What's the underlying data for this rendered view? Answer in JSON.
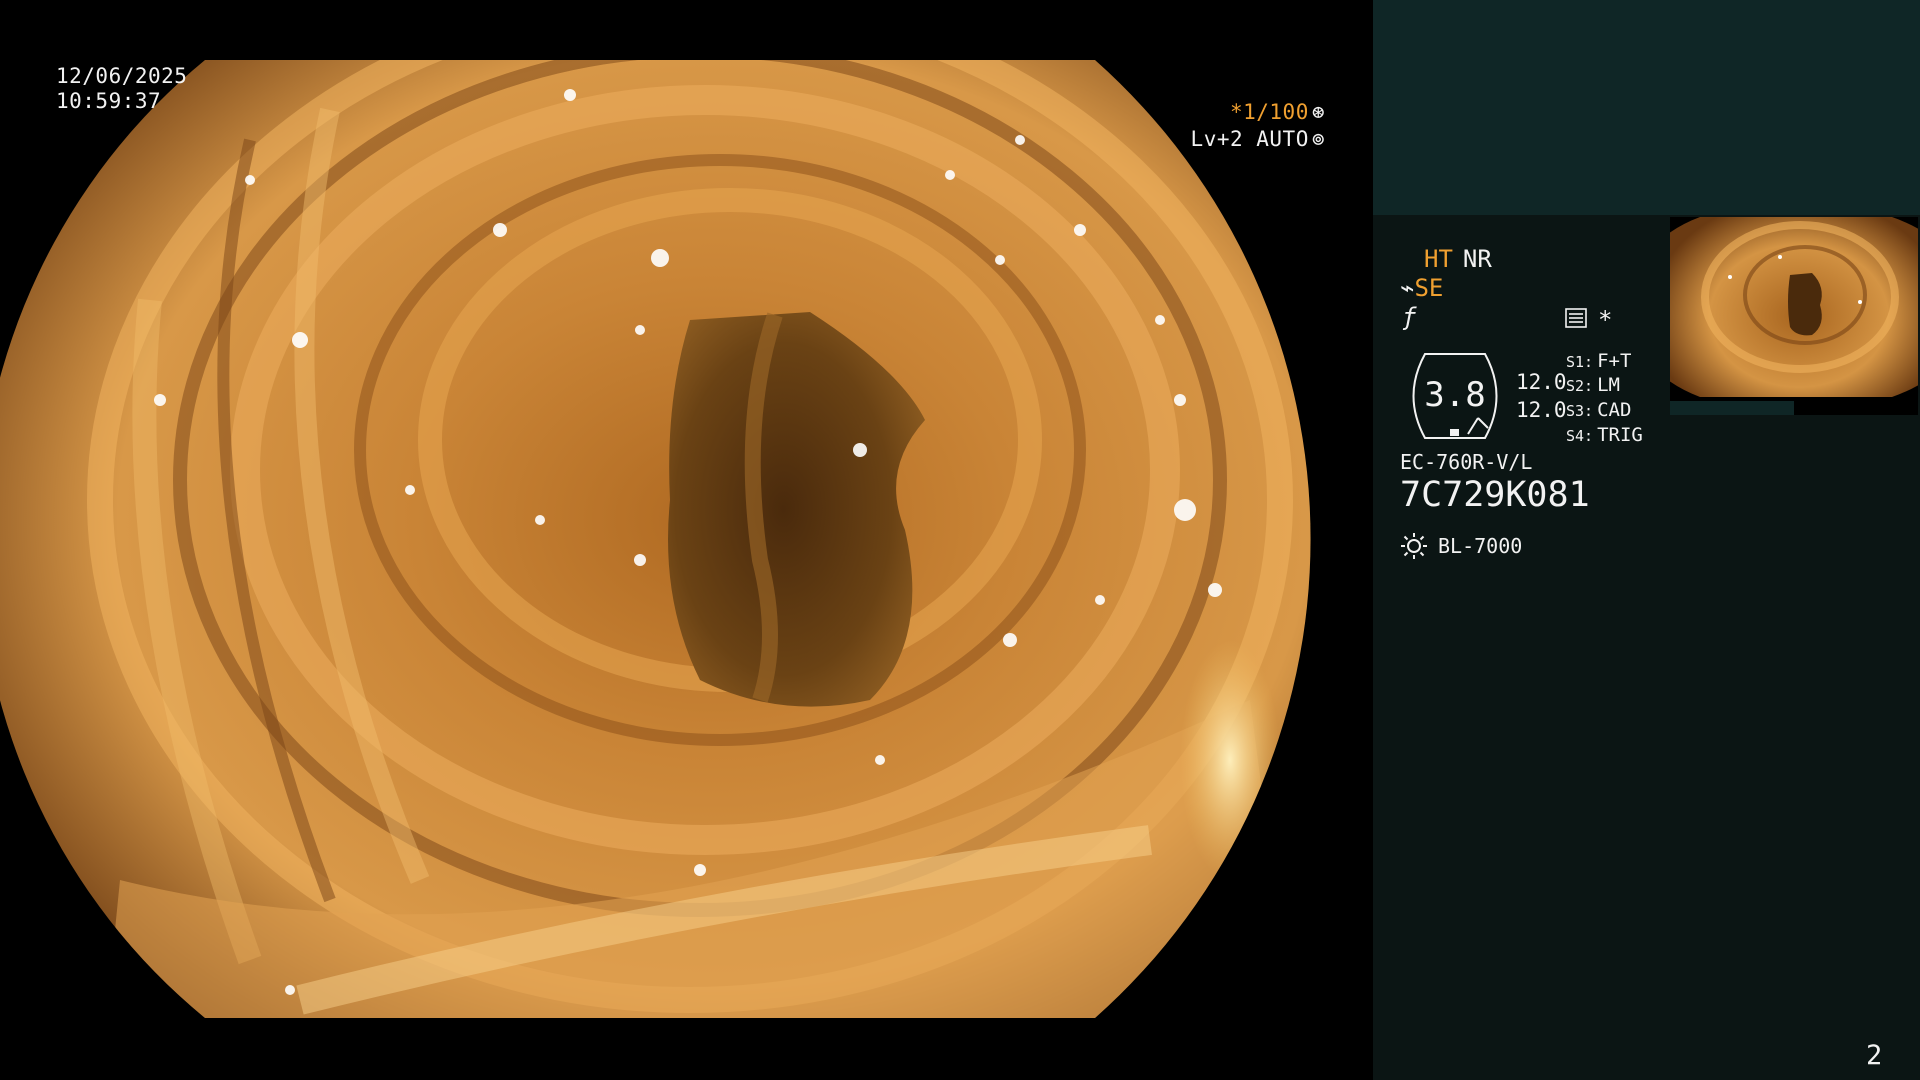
{
  "overlay": {
    "date": "12/06/2025",
    "time": "10:59:37",
    "shutter": "*1/100",
    "iris": "Lv+2 AUTO"
  },
  "panel": {
    "ht_label": "HT",
    "nr_label": "NR",
    "se_label": "SE",
    "star_mark": "*",
    "zoom_value": "3.8",
    "value_a": "12.0",
    "value_b": "12.0",
    "switches": [
      {
        "key": "S1:",
        "value": "F+T"
      },
      {
        "key": "S2:",
        "value": "LM"
      },
      {
        "key": "S3:",
        "value": "CAD"
      },
      {
        "key": "S4:",
        "value": "TRIG"
      }
    ],
    "scope_model": "EC-760R-V/L",
    "scope_serial": "7C729K081",
    "light_source": "BL-7000"
  },
  "page_number": "2",
  "icons": {
    "shutter": "aperture-icon",
    "iris": "iris-icon",
    "enhance": "enhance-icon",
    "menu": "menu-icon",
    "light": "light-bulb-icon"
  },
  "colors": {
    "accent_orange": "#f0a030",
    "panel_bg": "#0b1514",
    "panel_top_bg": "#0f2626",
    "text": "#f2f2f2"
  }
}
